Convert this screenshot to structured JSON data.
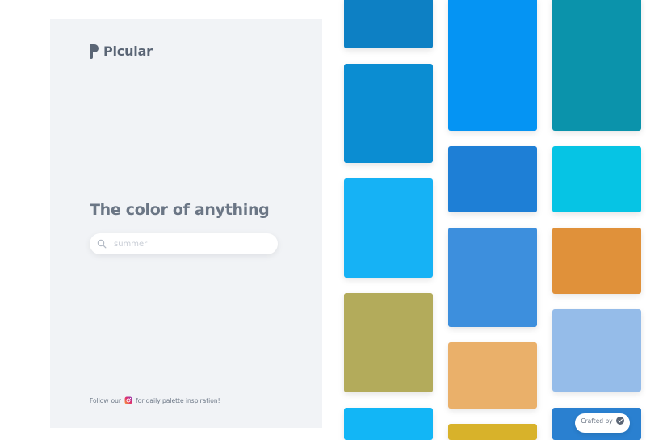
{
  "brand": {
    "name": "Picular"
  },
  "hero": {
    "headline": "The color of anything"
  },
  "search": {
    "placeholder": "summer"
  },
  "footer": {
    "follow_link": "Follow",
    "our": "our",
    "tail": "for daily palette inspiration!"
  },
  "crafted": {
    "label": "Crafted by"
  },
  "swatches": [
    {
      "color": "#0d80c4"
    },
    {
      "color": "#0b8dd2"
    },
    {
      "color": "#16b2f5"
    },
    {
      "color": "#b3ab5b"
    },
    {
      "color": "#12b6f6"
    },
    {
      "color": "#0594f3"
    },
    {
      "color": "#1e7fd6"
    },
    {
      "color": "#3d8fdd"
    },
    {
      "color": "#eab06a"
    },
    {
      "color": "#d8b22a"
    },
    {
      "color": "#0b93ab"
    },
    {
      "color": "#06c4e4"
    },
    {
      "color": "#e0913a"
    },
    {
      "color": "#95bce9"
    },
    {
      "color": "#2a80d0"
    }
  ]
}
